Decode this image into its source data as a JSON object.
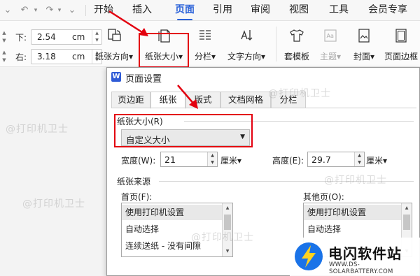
{
  "quick_access": {
    "undo_icon": "undo-icon",
    "redo_icon": "redo-icon",
    "more_icon": "chevron-down-icon"
  },
  "menu": {
    "tabs": [
      {
        "label": "开始",
        "active": false
      },
      {
        "label": "插入",
        "active": false
      },
      {
        "label": "页面",
        "active": true
      },
      {
        "label": "引用",
        "active": false
      },
      {
        "label": "审阅",
        "active": false
      },
      {
        "label": "视图",
        "active": false
      },
      {
        "label": "工具",
        "active": false
      },
      {
        "label": "会员专享",
        "active": false
      }
    ],
    "accent_color": "#2b62d9"
  },
  "ribbon": {
    "margins": {
      "bottom_label": "下:",
      "bottom_value": "2.54",
      "right_label": "右:",
      "right_value": "3.18",
      "unit": "cm"
    },
    "tools": {
      "orientation": "纸张方向",
      "size": "纸张大小",
      "columns": "分栏",
      "text_direction": "文字方向",
      "templates": "套模板",
      "theme": "主题",
      "cover": "封面",
      "page_border": "页面边框"
    },
    "dropdown_marker": "▾"
  },
  "watermarks": [
    "@打印机卫士",
    "@打印机卫士",
    "@打印机卫士",
    "@打印机卫士",
    "@打印机卫士"
  ],
  "dialog": {
    "logo": "W",
    "title": "页面设置",
    "tabs": [
      {
        "label": "页边距",
        "active": false
      },
      {
        "label": "纸张",
        "active": true
      },
      {
        "label": "版式",
        "active": false
      },
      {
        "label": "文档网格",
        "active": false
      },
      {
        "label": "分栏",
        "active": false
      }
    ],
    "paper_size": {
      "label": "纸张大小(R)",
      "value": "自定义大小"
    },
    "width": {
      "label": "宽度(W):",
      "value": "21",
      "unit": "厘米"
    },
    "height": {
      "label": "高度(E):",
      "value": "29.7",
      "unit": "厘米"
    },
    "paper_source": {
      "label": "纸张来源",
      "first_page": {
        "label": "首页(F):",
        "items": [
          "使用打印机设置",
          "自动选择",
          "连续送纸 - 没有间隙"
        ]
      },
      "other_pages": {
        "label": "其他页(O):",
        "items": [
          "使用打印机设置",
          "自动选择"
        ]
      }
    }
  },
  "highlight_color": "#e3000f",
  "brand": {
    "name": "电闪软件站",
    "url": "WWW.DS-SOLARBATTERY.COM"
  }
}
